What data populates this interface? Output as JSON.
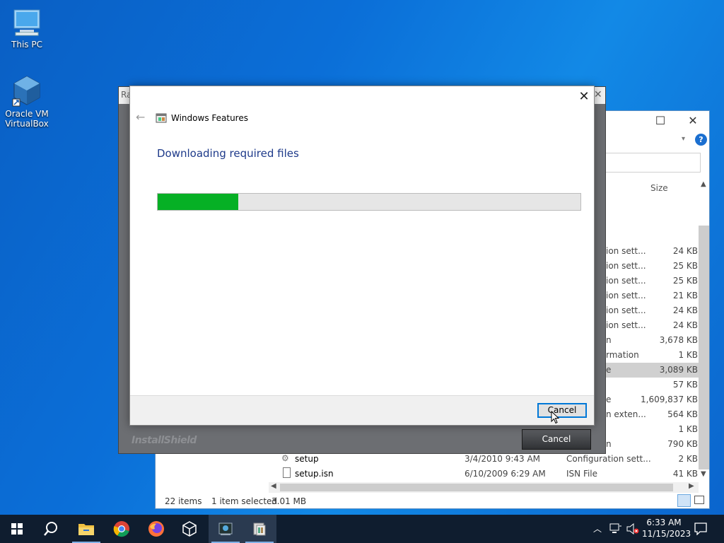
{
  "desktop": {
    "icons": [
      {
        "label": "This PC"
      },
      {
        "label": "Oracle VM VirtualBox"
      }
    ]
  },
  "explorer": {
    "column_size": "Size",
    "rows": [
      {
        "type": "ion sett...",
        "size": "24 KB"
      },
      {
        "type": "ion sett...",
        "size": "25 KB"
      },
      {
        "type": "ion sett...",
        "size": "25 KB"
      },
      {
        "type": "ion sett...",
        "size": "21 KB"
      },
      {
        "type": "ion sett...",
        "size": "24 KB"
      },
      {
        "type": "ion sett...",
        "size": "24 KB"
      },
      {
        "type": "n",
        "size": "3,678 KB"
      },
      {
        "type": "rmation",
        "size": "1 KB"
      },
      {
        "type": "e",
        "size": "3,089 KB",
        "selected": true
      },
      {
        "type": "",
        "size": "57 KB"
      },
      {
        "type": "e",
        "size": "1,609,837 KB"
      },
      {
        "type": "n exten...",
        "size": "564 KB"
      },
      {
        "type": "",
        "size": "1 KB"
      },
      {
        "type": "n",
        "size": "790 KB"
      }
    ],
    "full_rows": [
      {
        "name": "setup",
        "date": "3/4/2010 9:43 AM",
        "type": "Configuration sett...",
        "size": "2 KB"
      },
      {
        "name": "setup.isn",
        "date": "6/10/2009 6:29 AM",
        "type": "ISN File",
        "size": "41 KB"
      }
    ],
    "status": {
      "items": "22 items",
      "selected": "1 item selected",
      "size": "3.01 MB"
    }
  },
  "installshield": {
    "title_fragment": "Ra",
    "cancel_label": "Cancel",
    "logo": "InstallShield"
  },
  "windows_features": {
    "title": "Windows Features",
    "heading": "Downloading required files",
    "progress_percent": 19,
    "cancel_label": "Cancel"
  },
  "taskbar": {
    "time": "6:33 AM",
    "date": "11/15/2023"
  }
}
